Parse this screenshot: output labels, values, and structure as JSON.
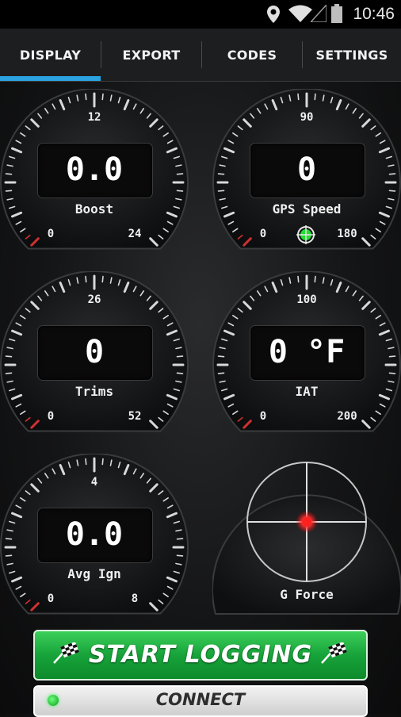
{
  "status_bar": {
    "time": "10:46",
    "icons": [
      "location-icon",
      "wifi-icon",
      "signal-icon",
      "battery-icon"
    ]
  },
  "tabs": [
    {
      "label": "DISPLAY",
      "selected": true
    },
    {
      "label": "EXPORT",
      "selected": false
    },
    {
      "label": "CODES",
      "selected": false
    },
    {
      "label": "SETTINGS",
      "selected": false
    }
  ],
  "gauges": {
    "boost": {
      "title": "Boost",
      "value": "0.0",
      "min": "0",
      "mid": "12",
      "max": "24"
    },
    "gps_speed": {
      "title": "GPS Speed",
      "value": "0",
      "min": "0",
      "mid": "90",
      "max": "180"
    },
    "trims": {
      "title": "Trims",
      "value": "0",
      "min": "0",
      "mid": "26",
      "max": "52"
    },
    "iat": {
      "title": "IAT",
      "value": "0 °F",
      "min": "0",
      "mid": "100",
      "max": "200"
    },
    "avg_ign": {
      "title": "Avg Ign",
      "value": "0.0",
      "min": "0",
      "mid": "4",
      "max": "8"
    }
  },
  "gforce": {
    "title": "G Force"
  },
  "buttons": {
    "start_logging": "START LOGGING",
    "connect": "CONNECT"
  },
  "colors": {
    "accent": "#2aa3e0",
    "start_green": "#17a33a",
    "gps_indicator": "#22dd33",
    "gforce_dot": "#ff2222"
  }
}
